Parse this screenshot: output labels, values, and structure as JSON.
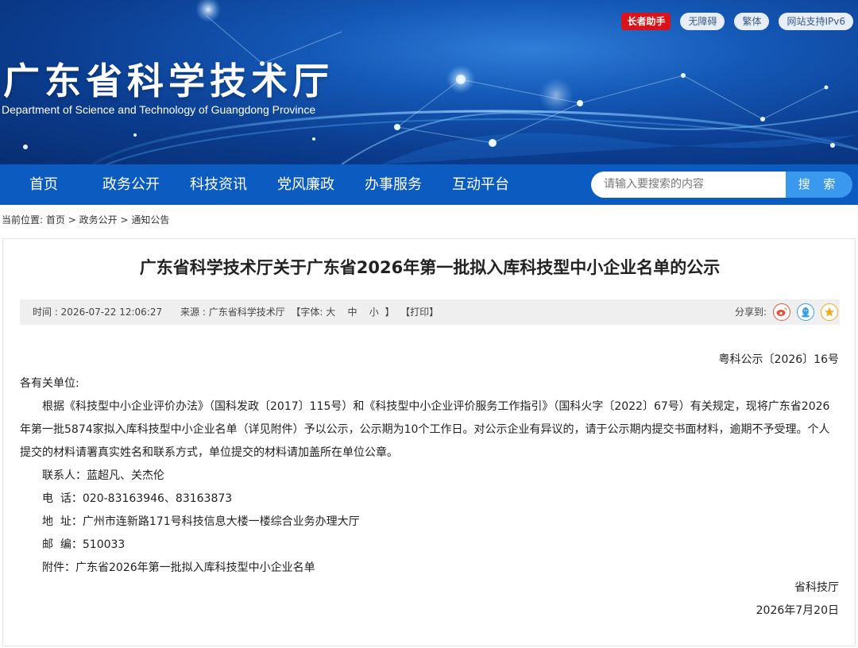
{
  "header": {
    "title": "广东省科学技术厅",
    "subtitle": "Department of Science and Technology of Guangdong Province",
    "top_links": [
      "长者助手",
      "无障碍",
      "繁体",
      "网站支持IPv6"
    ]
  },
  "nav": {
    "items": [
      "首页",
      "政务公开",
      "科技资讯",
      "党风廉政",
      "办事服务",
      "互动平台"
    ],
    "search_placeholder": "请输入要搜索的内容",
    "search_button": "搜 索"
  },
  "breadcrumb": {
    "prefix": "当前位置:",
    "items": [
      "首页",
      "政务公开",
      "通知公告"
    ],
    "separator": ">"
  },
  "article": {
    "title": "广东省科学技术厅关于广东省2026年第一批拟入库科技型中小企业名单的公示",
    "meta": {
      "time": "时间 : 2026-07-22 12:06:27",
      "source": "来源 : 广东省科学技术厅",
      "font_label": "【字体:",
      "font_sizes": [
        "大",
        "中",
        "小"
      ],
      "font_close": "】",
      "print": "【打印】",
      "share_label": "分享到:"
    },
    "doc_no": "粤科公示〔2026〕16号",
    "salutation": "各有关单位:",
    "paragraph": "根据《科技型中小企业评价办法》（国科发政〔2017〕115号）和《科技型中小企业评价服务工作指引》（国科火字〔2022〕67号）有关规定，现将广东省2026年第一批5874家拟入库科技型中小企业名单（详见附件）予以公示，公示期为10个工作日。对公示企业有异议的，请于公示期内提交书面材料，逾期不予受理。个人提交的材料请署真实姓名和联系方式，单位提交的材料请加盖所在单位公章。",
    "contact": "联系人：蓝超凡、关杰伦",
    "phone": "电  话：020-83163946、83163873",
    "address": "地  址：广州市连新路171号科技信息大楼一楼综合业务办理大厅",
    "postcode": "邮  编：510033",
    "attachment_label": "附件：",
    "attachment": "广东省2026年第一批拟入库科技型中小企业名单",
    "signature": "省科技厅",
    "date": "2026年7月20日"
  },
  "colors": {
    "nav_bg": "#0c5bc0",
    "search_btn": "#3a98ee",
    "helper_red": "#d8141a",
    "weibo": "#e2533b",
    "qq": "#3aa0e6",
    "qzone": "#f0a81c"
  },
  "icons": [
    "weibo-icon",
    "qq-icon",
    "qzone-icon"
  ]
}
